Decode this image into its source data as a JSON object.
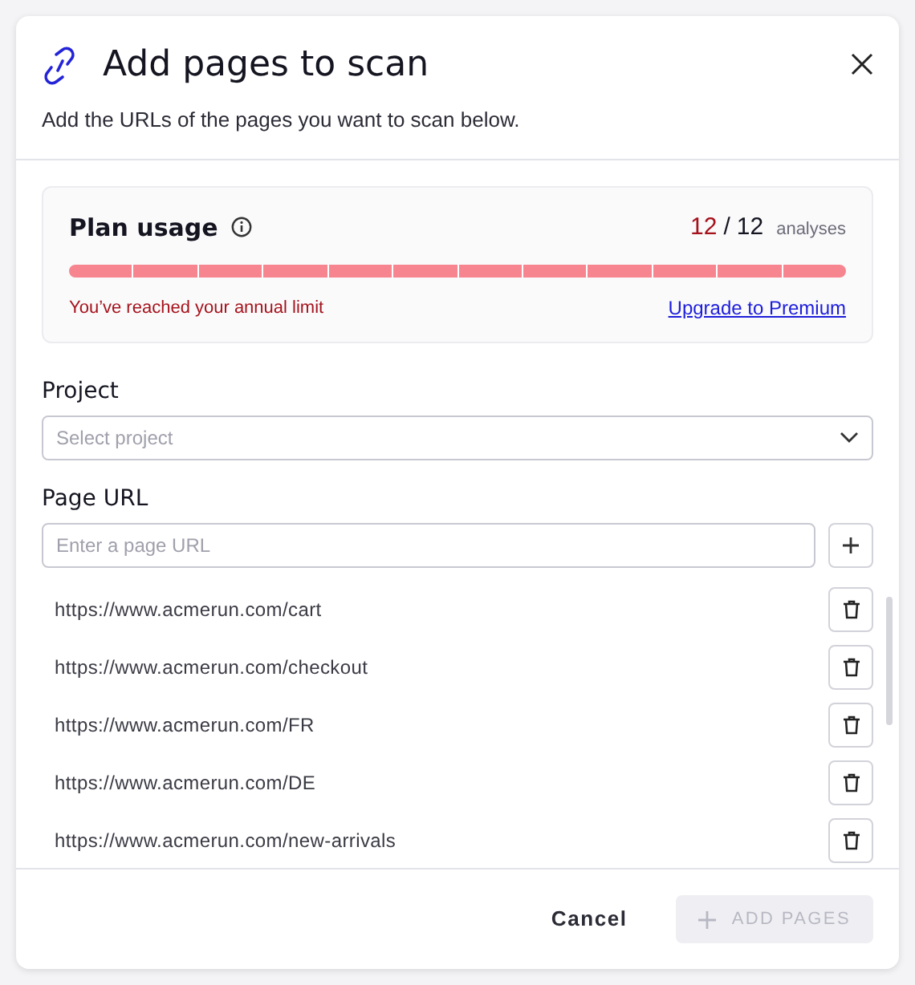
{
  "dialog": {
    "title": "Add pages to scan",
    "subtitle": "Add the URLs of the pages you want to scan below."
  },
  "plan_usage": {
    "title": "Plan usage",
    "used": "12",
    "separator": "/",
    "total": "12",
    "unit": "analyses",
    "warning": "You’ve reached your annual limit",
    "upgrade_link": "Upgrade to Premium"
  },
  "project": {
    "label": "Project",
    "placeholder": "Select project"
  },
  "page_url": {
    "label": "Page URL",
    "placeholder": "Enter a page URL"
  },
  "urls": [
    {
      "url": "https://www.acmerun.com/cart"
    },
    {
      "url": "https://www.acmerun.com/checkout"
    },
    {
      "url": "https://www.acmerun.com/FR"
    },
    {
      "url": "https://www.acmerun.com/DE"
    },
    {
      "url": "https://www.acmerun.com/new-arrivals"
    }
  ],
  "footer": {
    "cancel": "Cancel",
    "add": {
      "label": "ADD PAGES",
      "disabled": true
    }
  }
}
